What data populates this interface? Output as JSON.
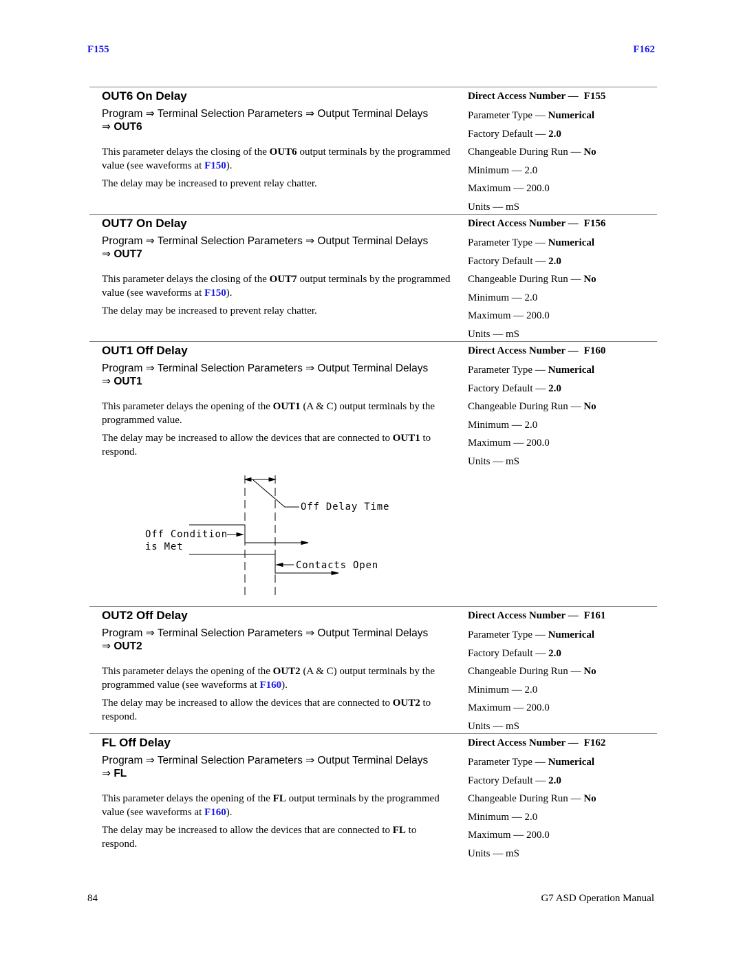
{
  "header": {
    "left_link": "F155",
    "right_link": "F162"
  },
  "labels": {
    "direct_access": "Direct Access Number —",
    "param_type": "Parameter Type —",
    "factory_default": "Factory Default —",
    "changeable": "Changeable During Run —",
    "minimum": "Minimum —",
    "maximum": "Maximum —",
    "units": "Units —",
    "arrow": "⇒"
  },
  "sections": [
    {
      "title": "OUT6 On Delay",
      "path": "Program ⇒ Terminal Selection Parameters ⇒ Output Terminal Delays",
      "path_terminal": "OUT6",
      "para1": {
        "pre": "This parameter delays the closing of the ",
        "bold": "OUT6",
        "mid": " output terminals by the programmed value (see waveforms at ",
        "link": "F150",
        "post": ")."
      },
      "para2": {
        "pre": "The delay may be increased to prevent relay chatter.",
        "bold": "",
        "post": ""
      },
      "props": {
        "direct_access_number": "F155",
        "parameter_type": "Numerical",
        "factory_default": "2.0",
        "changeable_during_run": "No",
        "minimum": "2.0",
        "maximum": "200.0",
        "units": "mS"
      }
    },
    {
      "title": "OUT7 On Delay",
      "path": "Program ⇒ Terminal Selection Parameters ⇒ Output Terminal Delays",
      "path_terminal": "OUT7",
      "para1": {
        "pre": "This parameter delays the closing of the ",
        "bold": "OUT7",
        "mid": " output terminals by the programmed value (see waveforms at ",
        "link": "F150",
        "post": ")."
      },
      "para2": {
        "pre": "The delay may be increased to prevent relay chatter.",
        "bold": "",
        "post": ""
      },
      "props": {
        "direct_access_number": "F156",
        "parameter_type": "Numerical",
        "factory_default": "2.0",
        "changeable_during_run": "No",
        "minimum": "2.0",
        "maximum": "200.0",
        "units": "mS"
      }
    },
    {
      "title": "OUT1 Off Delay",
      "path": "Program ⇒ Terminal Selection Parameters ⇒ Output Terminal Delays",
      "path_terminal": "OUT1",
      "para1": {
        "pre": "This parameter delays the opening of the ",
        "bold": "OUT1",
        "mid": " (A & C) output terminals by the programmed value.",
        "link": "",
        "post": ""
      },
      "para2": {
        "pre": "The delay may be increased to allow the devices that are connected to ",
        "bold": "OUT1",
        "post": " to respond."
      },
      "props": {
        "direct_access_number": "F160",
        "parameter_type": "Numerical",
        "factory_default": "2.0",
        "changeable_during_run": "No",
        "minimum": "2.0",
        "maximum": "200.0",
        "units": "mS"
      }
    },
    {
      "title": "OUT2 Off Delay",
      "path": "Program ⇒ Terminal Selection Parameters ⇒ Output Terminal Delays",
      "path_terminal": "OUT2",
      "para1": {
        "pre": "This parameter delays the opening of the ",
        "bold": "OUT2",
        "mid": " (A & C) output terminals by the programmed value (see waveforms at ",
        "link": "F160",
        "post": ")."
      },
      "para2": {
        "pre": "The delay may be increased to allow the devices that are connected to ",
        "bold": "OUT2",
        "post": " to respond."
      },
      "props": {
        "direct_access_number": "F161",
        "parameter_type": "Numerical",
        "factory_default": "2.0",
        "changeable_during_run": "No",
        "minimum": "2.0",
        "maximum": "200.0",
        "units": "mS"
      }
    },
    {
      "title": "FL Off Delay",
      "path": "Program ⇒ Terminal Selection Parameters ⇒ Output Terminal Delays",
      "path_terminal": "FL",
      "para1": {
        "pre": "This parameter delays the opening of the ",
        "bold": "FL",
        "mid": " output terminals by the programmed value (see waveforms at ",
        "link": "F160",
        "post": ")."
      },
      "para2": {
        "pre": "The delay may be increased to allow the devices that are connected to ",
        "bold": "FL",
        "post": " to respond."
      },
      "props": {
        "direct_access_number": "F162",
        "parameter_type": "Numerical",
        "factory_default": "2.0",
        "changeable_during_run": "No",
        "minimum": "2.0",
        "maximum": "200.0",
        "units": "mS"
      }
    }
  ],
  "diagram": {
    "label_off_delay_time": "Off Delay Time",
    "label_off_condition_line1": "Off Condition",
    "label_off_condition_line2": "is Met",
    "label_contacts_open": "Contacts Open"
  },
  "footer": {
    "page_number": "84",
    "manual_title": "G7 ASD Operation Manual"
  }
}
